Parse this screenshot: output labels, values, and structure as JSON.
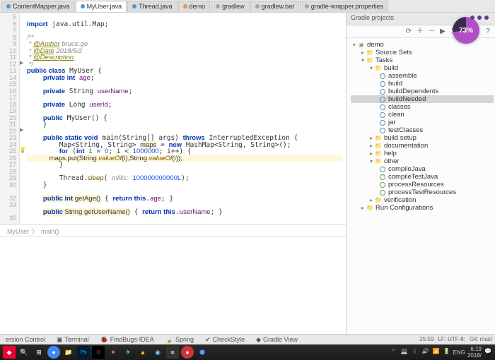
{
  "tabs": [
    {
      "label": "ContentMapper.java",
      "active": false
    },
    {
      "label": "MyUser.java",
      "active": true
    },
    {
      "label": "Thread.java",
      "active": false
    },
    {
      "label": "demo",
      "active": false
    },
    {
      "label": "gradlew",
      "active": false
    },
    {
      "label": "gradlew.bat",
      "active": false
    },
    {
      "label": "gradle-wrapper.properties",
      "active": false
    }
  ],
  "gradle_panel_title": "Gradle projects",
  "code": {
    "l5": "import java.util.Map;",
    "l6": "",
    "l7": "/**",
    "l8": " * @Author bruce.ge",
    "l9": " * @Date 2018/5/2",
    "l10": " * @Description",
    "l11": " */",
    "l12": "public class MyUser {",
    "l13": "    private int age;",
    "l14": "",
    "l15": "    private String userName;",
    "l16": "",
    "l17": "    private Long userId;",
    "l18": "",
    "l19": "    public MyUser() {",
    "l20": "    }",
    "l21": "",
    "l22": "    public static void main(String[] args) throws InterruptedException {",
    "l23": "        Map<String, String> maps = new HashMap<String, String>();",
    "l24": "        for (int i = 0; i < 1000000; i++) {",
    "l25": "            maps.put(String.valueOf(i),String.valueOf(i));",
    "l26": "        }",
    "l27": "",
    "l28": "        Thread.sleep( millis: 100000000000L);",
    "l29": "    }",
    "l30": "",
    "l32": "    public int getAge() { return this.age; }",
    "l33": "",
    "l35": "    public String getUserName() { return this.userName; }"
  },
  "breadcrumb": {
    "cls": "MyUser",
    "mth": "main()"
  },
  "pie_pct": "73%",
  "tree": {
    "root": "demo",
    "l1": "Source Sets",
    "l2": "Tasks",
    "build": "build",
    "items": [
      "assemble",
      "build",
      "buildDependents",
      "buildNeeded",
      "classes",
      "clean",
      "jar",
      "testClasses"
    ],
    "bs": "build setup",
    "doc": "documentation",
    "help": "help",
    "other": "other",
    "oitems": [
      "compileJava",
      "compileTestJava",
      "processResources",
      "processTestResources"
    ],
    "ver": "verification",
    "rc": "Run Configurations"
  },
  "bottom_tabs": [
    "ersion Control",
    "Terminal",
    "FindBugs-IDEA",
    "Spring",
    "CheckStyle",
    "Gradle View"
  ],
  "status": {
    "pos": "25:59",
    "enc": "LF: UTF-8:",
    "git": "Git: mast"
  },
  "tray": {
    "lang": "ENG",
    "date": "2018/",
    "time": "6:19"
  }
}
